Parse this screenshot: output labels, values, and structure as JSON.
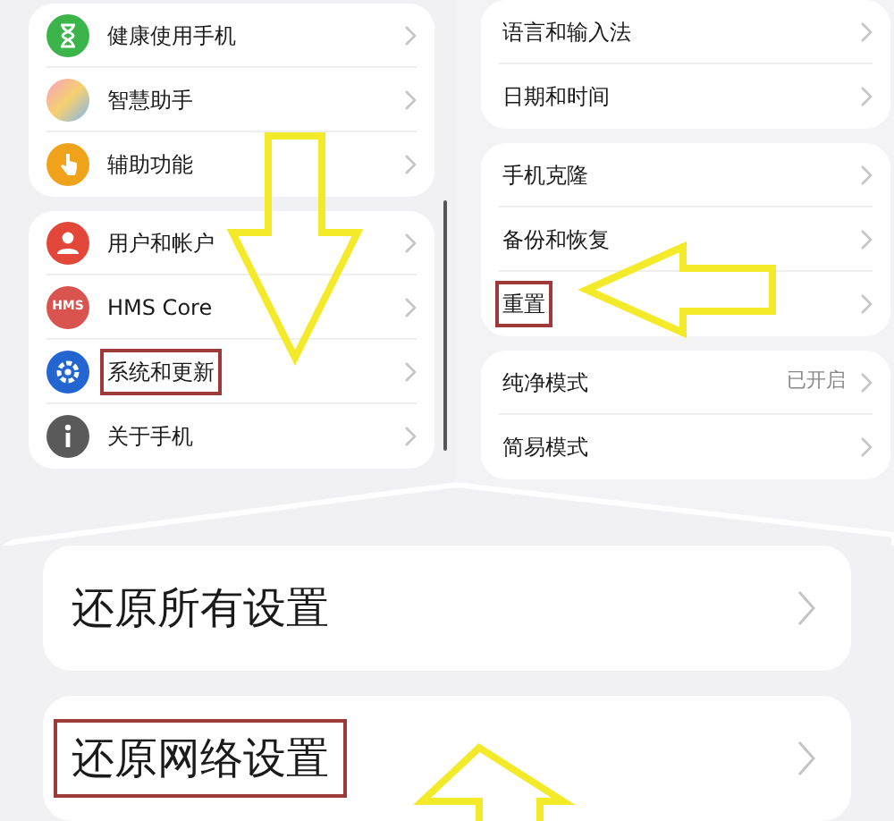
{
  "left_groups": [
    {
      "items": [
        {
          "label": "健康使用手机",
          "highlighted": false
        },
        {
          "label": "智慧助手",
          "highlighted": false
        },
        {
          "label": "辅助功能",
          "highlighted": false
        }
      ]
    },
    {
      "items": [
        {
          "label": "用户和帐户",
          "highlighted": false
        },
        {
          "label": "HMS Core",
          "icon_text": "HMS",
          "highlighted": false
        },
        {
          "label": "系统和更新",
          "highlighted": true
        },
        {
          "label": "关于手机",
          "highlighted": false
        }
      ]
    }
  ],
  "right_groups": [
    {
      "items": [
        {
          "label": "语言和输入法",
          "highlighted": false
        },
        {
          "label": "日期和时间",
          "highlighted": false
        }
      ]
    },
    {
      "items": [
        {
          "label": "手机克隆",
          "highlighted": false
        },
        {
          "label": "备份和恢复",
          "highlighted": false
        },
        {
          "label": "重置",
          "highlighted": true
        }
      ]
    },
    {
      "items": [
        {
          "label": "纯净模式",
          "value": "已开启",
          "highlighted": false
        },
        {
          "label": "简易模式",
          "highlighted": false
        }
      ]
    }
  ],
  "zoomed_items": [
    {
      "label": "还原所有设置",
      "highlighted": false
    },
    {
      "label": "还原网络设置",
      "highlighted": true
    }
  ],
  "annotations": [
    {
      "kind": "down_arrow"
    },
    {
      "kind": "left_arrow"
    },
    {
      "kind": "up_arrow"
    }
  ]
}
